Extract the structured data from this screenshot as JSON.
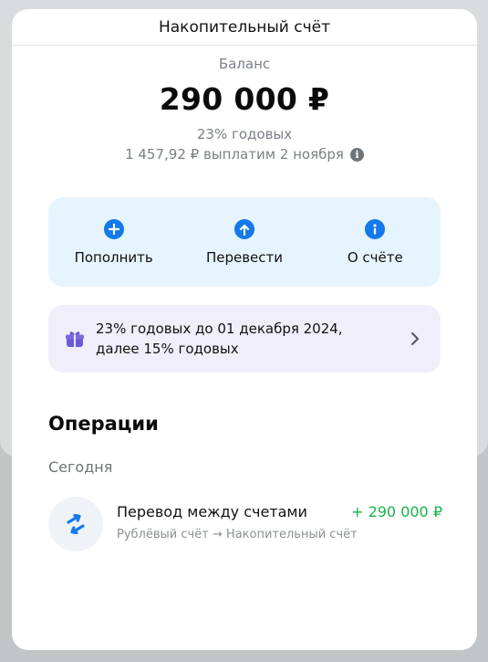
{
  "sheet": {
    "title": "Накопительный счёт"
  },
  "balance": {
    "label": "Баланс",
    "amount": "290 000 ₽",
    "rate": "23% годовых",
    "payout": "1 457,92 ₽ выплатим 2 ноября"
  },
  "actions": [
    {
      "label": "Пополнить",
      "icon": "plus-icon"
    },
    {
      "label": "Перевести",
      "icon": "arrow-up-icon"
    },
    {
      "label": "О счёте",
      "icon": "info-icon"
    }
  ],
  "promo": {
    "line1": "23% годовых до 01 декабря 2024,",
    "line2": "далее 15% годовых",
    "icon": "gift-icon"
  },
  "operations": {
    "title": "Операции",
    "group": "Сегодня",
    "items": [
      {
        "title": "Перевод между счетами",
        "amount": "+ 290 000 ₽",
        "subtitle": "Рублёвый счёт → Накопительный счёт",
        "icon": "transfer-arrows-icon"
      }
    ]
  },
  "colors": {
    "accent": "#1479ea",
    "actions_bg": "#e6f4fd",
    "promo_bg": "#f0eefa",
    "promo_icon": "#6a5bd6",
    "income": "#19b24b"
  }
}
